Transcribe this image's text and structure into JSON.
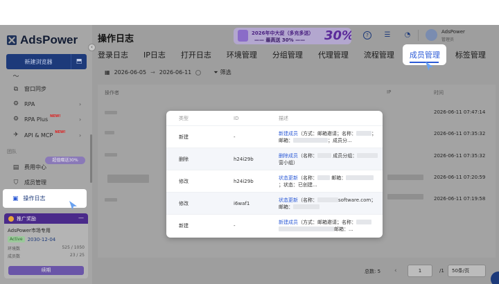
{
  "app": {
    "logo": "AdsPower",
    "page_title": "操作日志"
  },
  "sidebar": {
    "new_browser": "新建浏览器",
    "items": [
      {
        "label": "窗口同步"
      },
      {
        "label": "RPA"
      },
      {
        "label": "RPA Plus",
        "badge": "NEW!"
      },
      {
        "label": "API & MCP",
        "badge": "NEW!"
      }
    ],
    "section_label": "团队",
    "promo_pill": "超值赠送30%",
    "team_items": [
      {
        "label": "费用中心"
      },
      {
        "label": "成员管理"
      },
      {
        "label": "操作日志"
      }
    ],
    "promo_card": {
      "title": "推广奖励",
      "plan": "AdsPower市场专用",
      "status": "Active",
      "expiry": "2030-12-04",
      "stats": [
        {
          "label": "环境数",
          "value": "525 / 1050"
        },
        {
          "label": "成员数",
          "value": "23 / 25"
        }
      ],
      "renew_label": "续期"
    }
  },
  "header": {
    "banner": {
      "line1": "2026年中大促（多充多送）",
      "line2": "—— 最高送 30% ——",
      "big": "30%"
    },
    "user": {
      "name": "AdsPower",
      "role": "管理员"
    }
  },
  "tabs": [
    "登录日志",
    "IP日志",
    "打开日志",
    "环境管理",
    "分组管理",
    "代理管理",
    "流程管理",
    "成员管理",
    "标签管理"
  ],
  "active_tab": "成员管理",
  "filters": {
    "date_start": "2026-06-05",
    "date_sep": "→",
    "date_end": "2026-06-11",
    "filter_label": "筛选"
  },
  "table": {
    "columns": [
      "操作者",
      "IP",
      "时间"
    ],
    "times": [
      "2026-06-11 07:47:14",
      "2026-06-11 07:35:32",
      "2026-06-11 07:35:32",
      "2026-06-11 07:20:59",
      "2026-06-11 07:19:58"
    ]
  },
  "modal": {
    "columns": [
      "类型",
      "ID",
      "描述"
    ],
    "rows": [
      {
        "type": "新建",
        "id": "-",
        "desc_hl": "新建成员",
        "desc": "（方式：邮箱邀请；名称：",
        "desc2": "；邮箱：",
        "desc3": "；成员分..."
      },
      {
        "type": "删除",
        "id": "h24i29b",
        "desc_hl": "删除成员",
        "desc": "（名称：",
        "desc2": " 成员分组：",
        "desc3": "营小组）"
      },
      {
        "type": "修改",
        "id": "h24i29b",
        "desc_hl": "状态更新",
        "desc": "（名称：",
        "desc2": " 邮箱：",
        "desc3": "；状态：已创建..."
      },
      {
        "type": "修改",
        "id": "i6waf1",
        "desc_hl": "状态更新",
        "desc": "（名称：",
        "desc2": "software.com；邮箱：",
        "desc3": ""
      },
      {
        "type": "新建",
        "id": "-",
        "desc_hl": "新建成员",
        "desc": "（方式：邮箱邀请；名称：",
        "desc2": "",
        "desc3": "邮箱：..."
      }
    ]
  },
  "pagination": {
    "total": "总数: 5",
    "page": "1",
    "page_total": "/1",
    "page_size": "50条/页"
  },
  "colors": {
    "accent": "#2d5bd6",
    "brand": "#1d3a7a",
    "overlay": "#9e9e9e"
  }
}
